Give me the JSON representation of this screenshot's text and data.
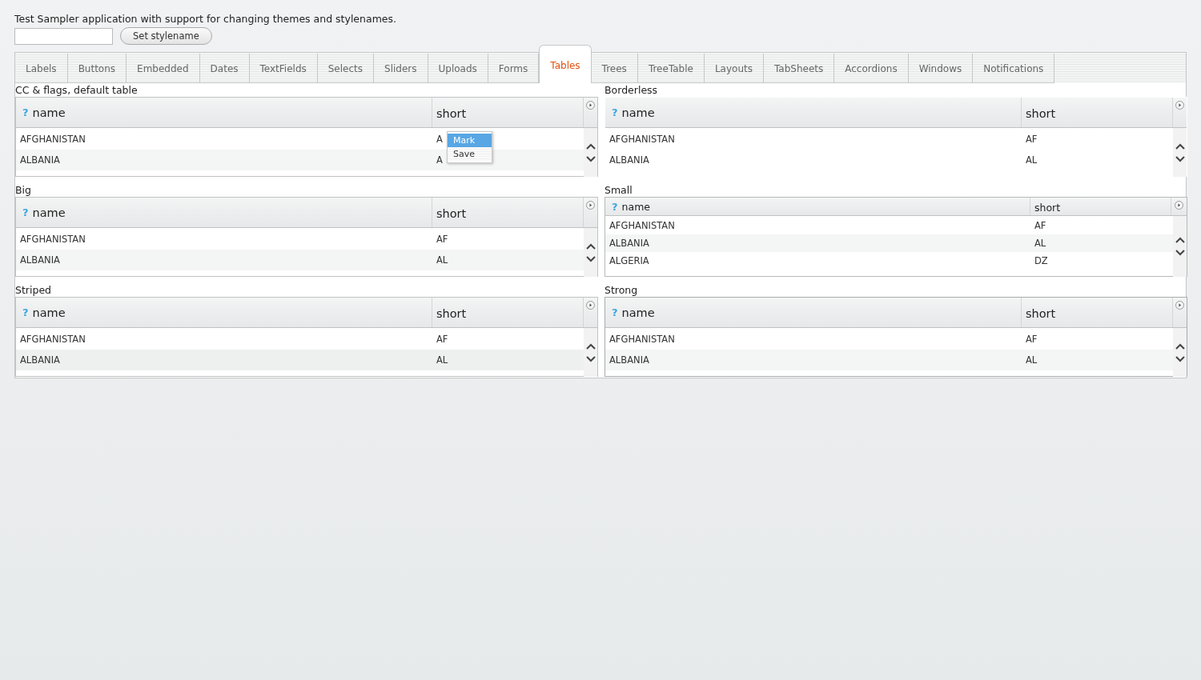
{
  "description": "Test Sampler application with support for changing themes and stylenames.",
  "stylename_button": "Set stylename",
  "tabs": [
    {
      "label": "Labels",
      "selected": false
    },
    {
      "label": "Buttons",
      "selected": false
    },
    {
      "label": "Embedded",
      "selected": false
    },
    {
      "label": "Dates",
      "selected": false
    },
    {
      "label": "TextFields",
      "selected": false
    },
    {
      "label": "Selects",
      "selected": false
    },
    {
      "label": "Sliders",
      "selected": false
    },
    {
      "label": "Uploads",
      "selected": false
    },
    {
      "label": "Forms",
      "selected": false
    },
    {
      "label": "Tables",
      "selected": true
    },
    {
      "label": "Trees",
      "selected": false
    },
    {
      "label": "TreeTable",
      "selected": false
    },
    {
      "label": "Layouts",
      "selected": false
    },
    {
      "label": "TabSheets",
      "selected": false
    },
    {
      "label": "Accordions",
      "selected": false
    },
    {
      "label": "Windows",
      "selected": false
    },
    {
      "label": "Notifications",
      "selected": false
    }
  ],
  "tables": [
    {
      "caption": "CC & flags, default table",
      "kind": "default",
      "help_mark": "?",
      "columns": [
        "name",
        "short"
      ],
      "rows": [
        {
          "name": "AFGHANISTAN",
          "short": "A"
        },
        {
          "name": "ALBANIA",
          "short": "A"
        }
      ],
      "context_menu": [
        {
          "label": "Mark",
          "selected": true
        },
        {
          "label": "Save",
          "selected": false
        }
      ]
    },
    {
      "caption": "Borderless",
      "kind": "borderless",
      "help_mark": "?",
      "columns": [
        "name",
        "short"
      ],
      "rows": [
        {
          "name": "AFGHANISTAN",
          "short": "AF"
        },
        {
          "name": "ALBANIA",
          "short": "AL"
        }
      ]
    },
    {
      "caption": "Big",
      "kind": "big",
      "help_mark": "?",
      "columns": [
        "name",
        "short"
      ],
      "rows": [
        {
          "name": "AFGHANISTAN",
          "short": "AF"
        },
        {
          "name": "ALBANIA",
          "short": "AL"
        }
      ]
    },
    {
      "caption": "Small",
      "kind": "small",
      "help_mark": "?",
      "columns": [
        "name",
        "short"
      ],
      "rows": [
        {
          "name": "AFGHANISTAN",
          "short": "AF"
        },
        {
          "name": "ALBANIA",
          "short": "AL"
        },
        {
          "name": "ALGERIA",
          "short": "DZ"
        }
      ]
    },
    {
      "caption": "Striped",
      "kind": "striped",
      "help_mark": "?",
      "columns": [
        "name",
        "short"
      ],
      "rows": [
        {
          "name": "AFGHANISTAN",
          "short": "AF"
        },
        {
          "name": "ALBANIA",
          "short": "AL"
        }
      ]
    },
    {
      "caption": "Strong",
      "kind": "strong",
      "help_mark": "?",
      "columns": [
        "name",
        "short"
      ],
      "rows": [
        {
          "name": "AFGHANISTAN",
          "short": "AF"
        },
        {
          "name": "ALBANIA",
          "short": "AL"
        }
      ]
    }
  ]
}
